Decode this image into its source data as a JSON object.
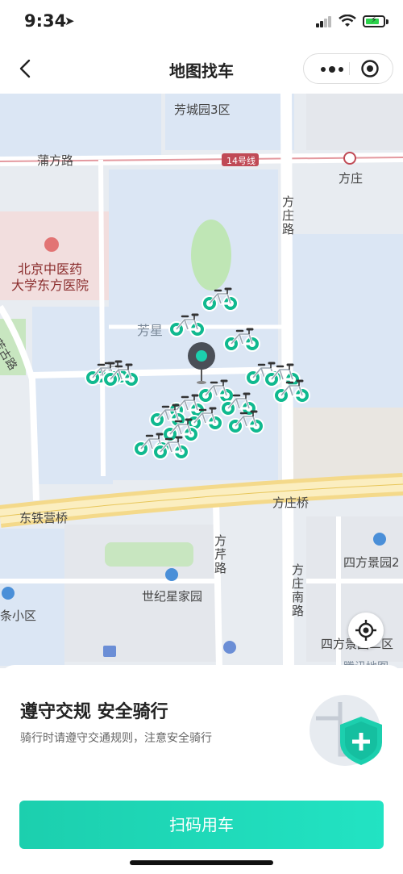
{
  "status_bar": {
    "time": "9:34"
  },
  "navbar": {
    "title": "地图找车"
  },
  "map": {
    "labels": {
      "fangcheng": "芳城园3区",
      "pufang": "蒲方路",
      "line14": "14号线",
      "fangzhuang": "方庄",
      "fangzhuang_road": "方庄路",
      "hospital_line1": "北京中医药",
      "hospital_line2": "大学东方医院",
      "fangxing": "芳星",
      "fanggu": "芳古路",
      "dongtieying": "东铁营桥",
      "fangzhuang_bridge": "方庄桥",
      "fangqin": "方芹路",
      "fangzhuang_south": "方庄南路",
      "sifang_2": "四方景园2",
      "century_star": "世纪星家园",
      "tiao_xiaoqu": "条小区",
      "sifang_bottom": "四方景园二区",
      "tencent_map": "腾讯地图"
    }
  },
  "sheet": {
    "title": "遵守交规 安全骑行",
    "subtitle": "骑行时请遵守交通规则，注意安全骑行",
    "scan_button": "扫码用车"
  },
  "colors": {
    "accent": "#1ccfae",
    "bike": "#10b98f",
    "water": "#d9e5f4"
  }
}
